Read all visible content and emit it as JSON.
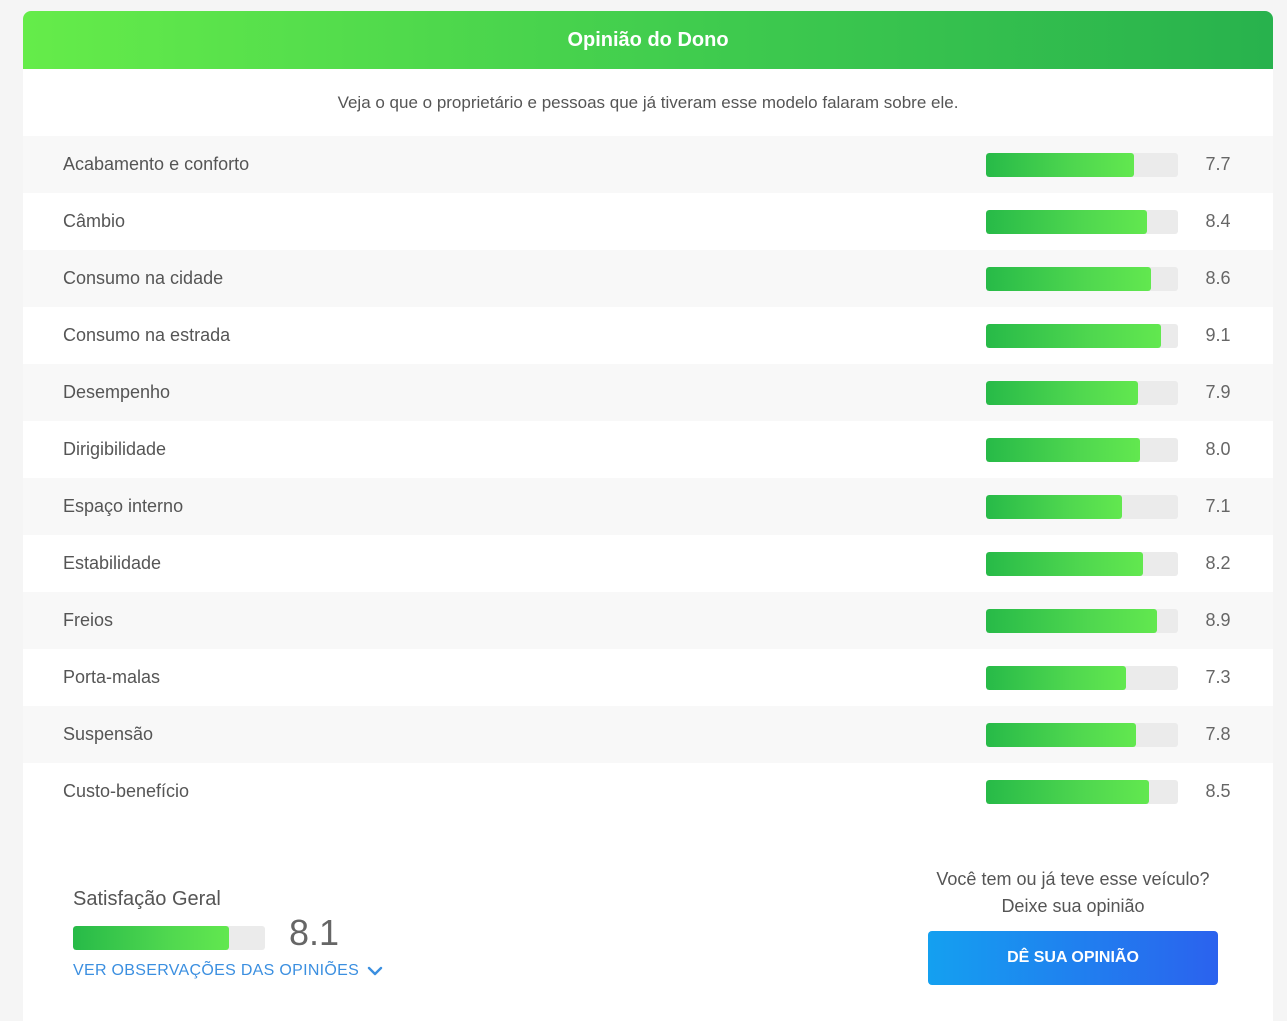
{
  "header": {
    "title": "Opinião do Dono"
  },
  "subtitle": "Veja o que o proprietário e pessoas que já tiveram esse modelo falaram sobre ele.",
  "colors": {
    "bar_fill": "#4fd74f",
    "bar_track": "#ebebeb",
    "header": "#3fcb4e",
    "button": "#2b62ee",
    "link": "#3b8fe0"
  },
  "ratings": [
    {
      "label": "Acabamento e conforto",
      "score": "7.7",
      "value": 7.7
    },
    {
      "label": "Câmbio",
      "score": "8.4",
      "value": 8.4
    },
    {
      "label": "Consumo na cidade",
      "score": "8.6",
      "value": 8.6
    },
    {
      "label": "Consumo na estrada",
      "score": "9.1",
      "value": 9.1
    },
    {
      "label": "Desempenho",
      "score": "7.9",
      "value": 7.9
    },
    {
      "label": "Dirigibilidade",
      "score": "8.0",
      "value": 8.0
    },
    {
      "label": "Espaço interno",
      "score": "7.1",
      "value": 7.1
    },
    {
      "label": "Estabilidade",
      "score": "8.2",
      "value": 8.2
    },
    {
      "label": "Freios",
      "score": "8.9",
      "value": 8.9
    },
    {
      "label": "Porta-malas",
      "score": "7.3",
      "value": 7.3
    },
    {
      "label": "Suspensão",
      "score": "7.8",
      "value": 7.8
    },
    {
      "label": "Custo-benefício",
      "score": "8.5",
      "value": 8.5
    }
  ],
  "overall": {
    "label": "Satisfação Geral",
    "score": "8.1",
    "value": 8.1,
    "link_label": "VER OBSERVAÇÕES DAS OPINIÕES",
    "link_icon": "chevron-down-icon"
  },
  "cta": {
    "line1": "Você tem ou já teve esse veículo?",
    "line2": "Deixe sua opinião",
    "button_label": "DÊ SUA OPINIÃO"
  }
}
